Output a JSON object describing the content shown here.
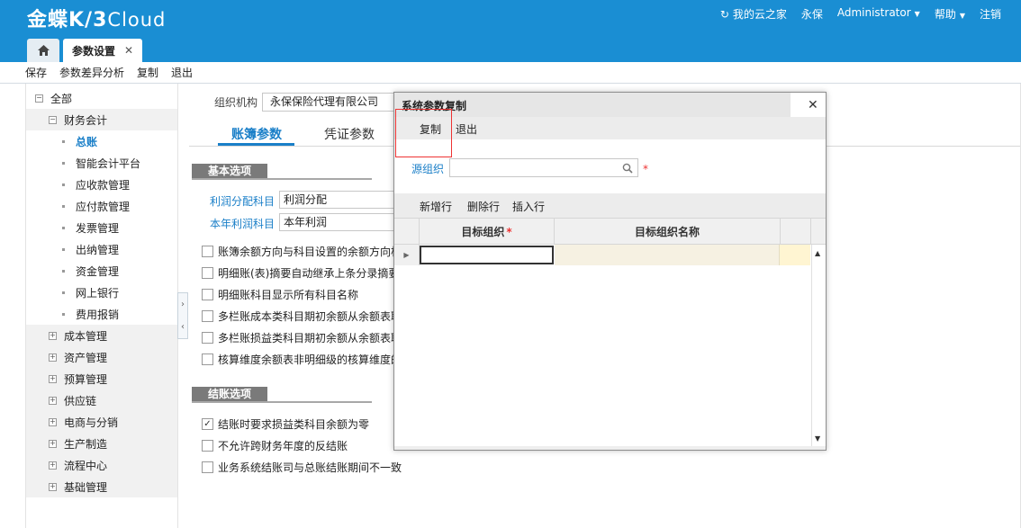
{
  "header": {
    "logo_main": "金蝶K/3",
    "logo_cloud": "Cloud",
    "nav": {
      "cloud_home": "我的云之家",
      "user_name": "永保",
      "account": "Administrator",
      "help": "帮助",
      "logout": "注销"
    }
  },
  "tabs": {
    "active_label": "参数设置",
    "close_glyph": "✕"
  },
  "toolbar": {
    "save": "保存",
    "diff_analysis": "参数差异分析",
    "copy": "复制",
    "exit": "退出"
  },
  "sidebar": {
    "items": [
      {
        "label": "全部",
        "level": 0,
        "toggle": "−"
      },
      {
        "label": "财务会计",
        "level": 1,
        "toggle": "−"
      },
      {
        "label": "总账",
        "level": 2,
        "active": true
      },
      {
        "label": "智能会计平台",
        "level": 2
      },
      {
        "label": "应收款管理",
        "level": 2
      },
      {
        "label": "应付款管理",
        "level": 2
      },
      {
        "label": "发票管理",
        "level": 2
      },
      {
        "label": "出纳管理",
        "level": 2
      },
      {
        "label": "资金管理",
        "level": 2
      },
      {
        "label": "网上银行",
        "level": 2
      },
      {
        "label": "费用报销",
        "level": 2
      },
      {
        "label": "成本管理",
        "level": 1,
        "toggle": "+"
      },
      {
        "label": "资产管理",
        "level": 1,
        "toggle": "+"
      },
      {
        "label": "预算管理",
        "level": 1,
        "toggle": "+"
      },
      {
        "label": "供应链",
        "level": 1,
        "toggle": "+"
      },
      {
        "label": "电商与分销",
        "level": 1,
        "toggle": "+"
      },
      {
        "label": "生产制造",
        "level": 1,
        "toggle": "+"
      },
      {
        "label": "流程中心",
        "level": 1,
        "toggle": "+"
      },
      {
        "label": "基础管理",
        "level": 1,
        "toggle": "+"
      }
    ]
  },
  "main": {
    "org_label": "组织机构",
    "org_value": "永保保险代理有限公司",
    "subtabs": [
      "账簿参数",
      "凭证参数"
    ],
    "basic_section": "基本选项",
    "profit_dist_label": "利润分配科目",
    "profit_dist_value": "利润分配",
    "current_profit_label": "本年利润科目",
    "current_profit_value": "本年利润",
    "basic_options": [
      {
        "label": "账簿余额方向与科目设置的余额方向相",
        "checked": false
      },
      {
        "label": "明细账(表)摘要自动继承上条分录摘要",
        "checked": false
      },
      {
        "label": "明细账科目显示所有科目名称",
        "checked": false
      },
      {
        "label": "多栏账成本类科目期初余额从余额表取",
        "checked": false
      },
      {
        "label": "多栏账损益类科目期初余额从余额表取",
        "checked": false
      },
      {
        "label": "核算维度余额表非明细级的核算维度的",
        "checked": false
      }
    ],
    "close_section": "结账选项",
    "close_options": [
      {
        "label": "结账时要求损益类科目余额为零",
        "checked": true
      },
      {
        "label": "不允许跨财务年度的反结账",
        "checked": false
      },
      {
        "label": "业务系统结账司与总账结账期间不一致",
        "checked": false
      }
    ]
  },
  "dialog": {
    "title": "系统参数复制",
    "close_glyph": "✕",
    "toolbar": {
      "copy": "复制",
      "exit": "退出"
    },
    "source_org_label": "源组织",
    "source_org_value": "",
    "required_mark": "*",
    "grid_toolbar": {
      "add_row": "新增行",
      "delete_row": "删除行",
      "insert_row": "插入行"
    },
    "columns": {
      "target_org": "目标组织",
      "target_org_name": "目标组织名称"
    }
  },
  "colors": {
    "header_bg": "#1a8ed3",
    "link_blue": "#1a7fc8",
    "required_red": "#e33333"
  }
}
